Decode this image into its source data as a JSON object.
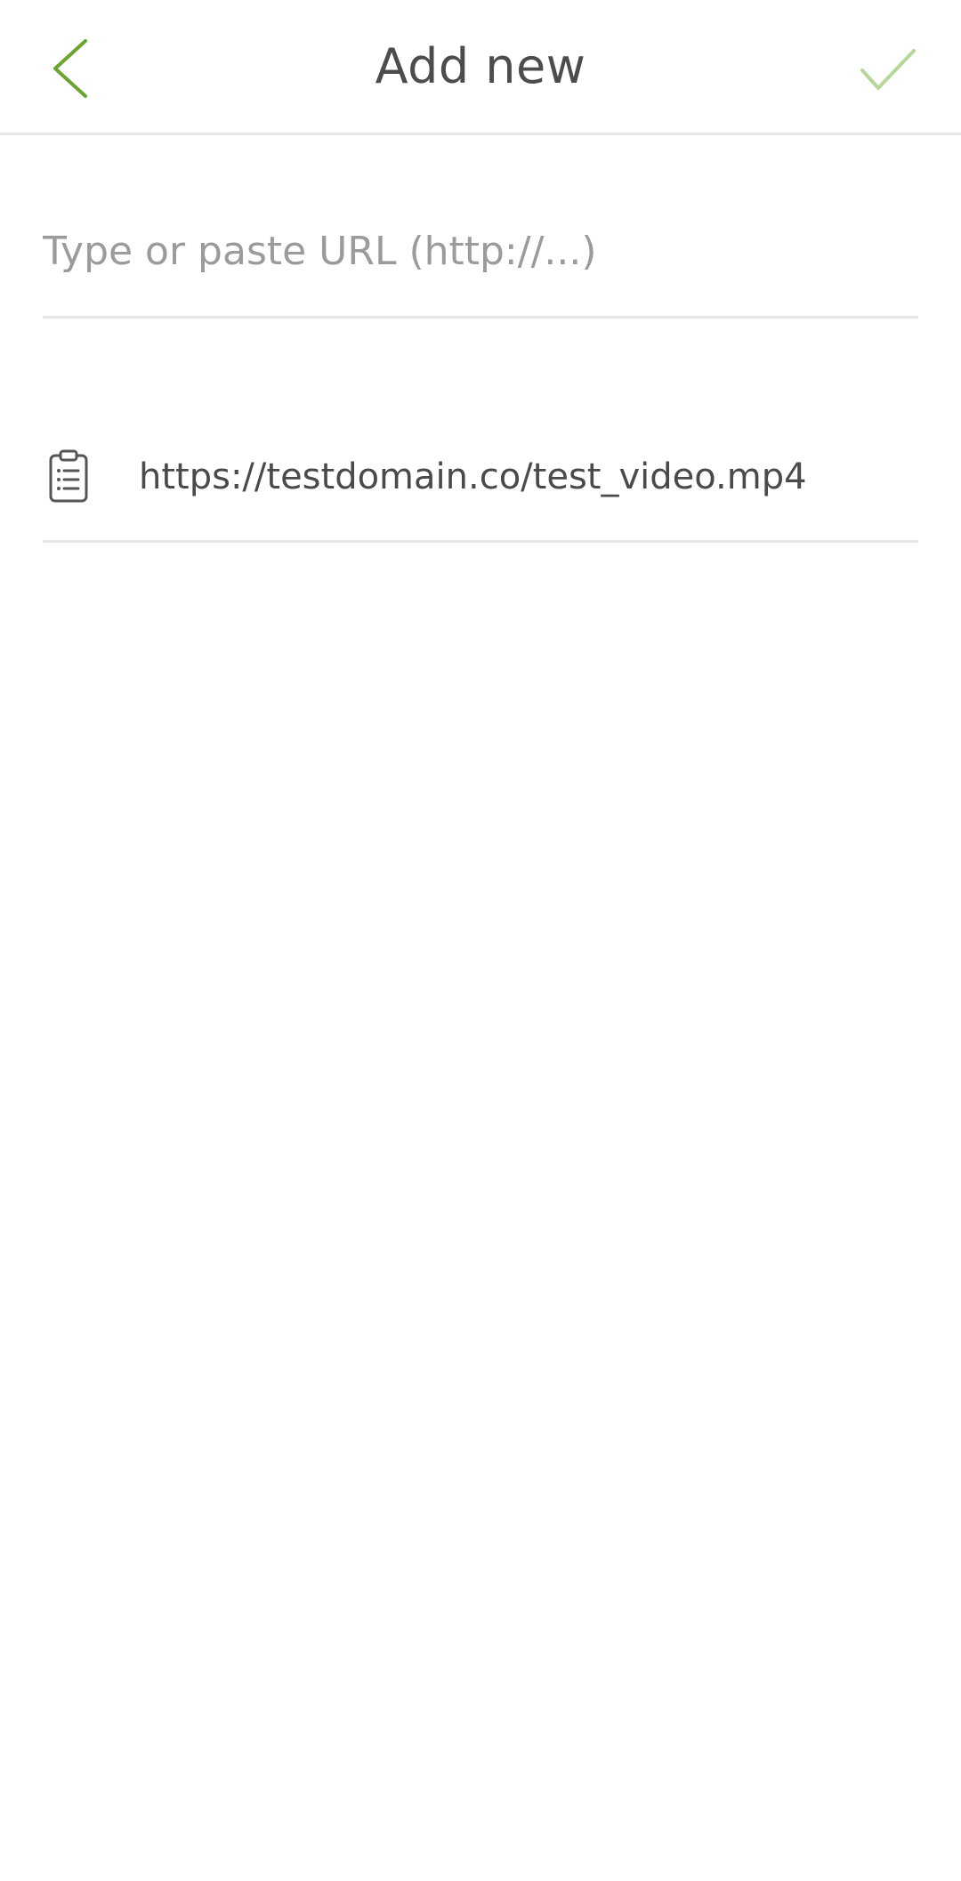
{
  "header": {
    "title": "Add new",
    "back_icon": "chevron-left-icon",
    "confirm_icon": "check-icon"
  },
  "url_input": {
    "value": "",
    "placeholder": "Type or paste URL (http://...)"
  },
  "clipboard_suggestion": {
    "icon": "clipboard-icon",
    "text": "https://testdomain.co/test_video.mp4"
  },
  "colors": {
    "accent": "#6aa532",
    "accent_light": "#b5d89a",
    "divider": "#e6e6e6",
    "text": "#4a4a4a",
    "placeholder": "#9b9b9b"
  }
}
